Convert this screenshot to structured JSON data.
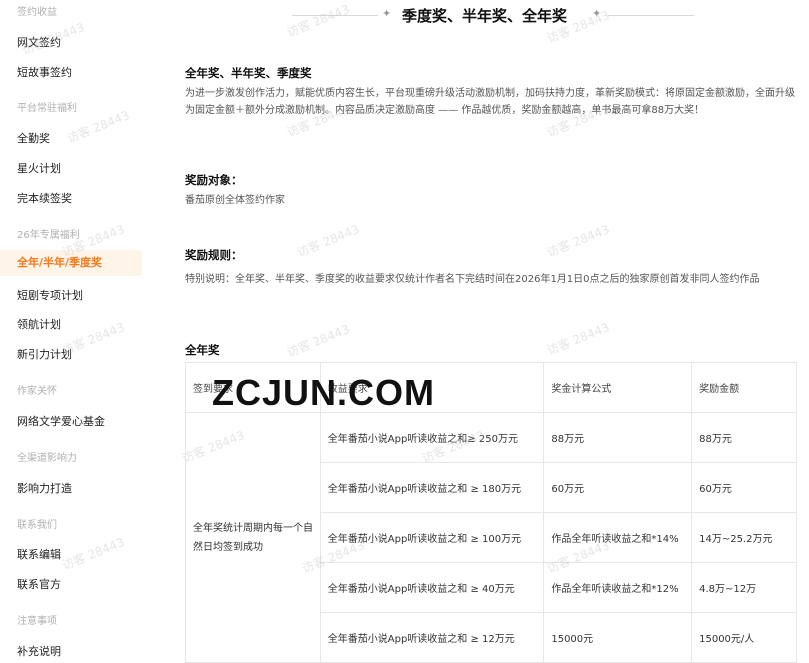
{
  "sidebar": {
    "sections": [
      {
        "label": "签约收益"
      },
      {
        "label": "平台常驻福利"
      },
      {
        "label": "26年专属福利"
      },
      {
        "label": "作家关怀"
      },
      {
        "label": "全渠道影响力"
      },
      {
        "label": "联系我们"
      },
      {
        "label": "注意事项"
      }
    ],
    "items": [
      {
        "label": "网文签约"
      },
      {
        "label": "短故事签约"
      },
      {
        "label": "全勤奖"
      },
      {
        "label": "星火计划"
      },
      {
        "label": "完本续签奖"
      },
      {
        "label": "全年/半年/季度奖"
      },
      {
        "label": "短剧专项计划"
      },
      {
        "label": "领航计划"
      },
      {
        "label": "新引力计划"
      },
      {
        "label": "网络文学爱心基金"
      },
      {
        "label": "影响力打造"
      },
      {
        "label": "联系编辑"
      },
      {
        "label": "联系官方"
      },
      {
        "label": "补充说明"
      }
    ],
    "active_item": "全年/半年/季度奖",
    "accent_color": "#f47a20"
  },
  "page": {
    "title": "季度奖、半年奖、全年奖",
    "title_decoration": "✦",
    "intro_heading": "全年奖、半年奖、季度奖",
    "intro_text": "为进一步激发创作活力，赋能优质内容生长，平台现重磅升级活动激励机制，加码扶持力度，革新奖励模式：将原固定金额激励，全面升级为固定金额＋额外分成激励机制。内容品质决定激励高度 —— 作品越优质，奖励金额越高，单书最高可拿88万大奖！",
    "target_heading": "奖励对象：",
    "target_text": "番茄原创全体签约作家",
    "rules_heading": "奖励规则：",
    "rules_text": "特别说明：全年奖、半年奖、季度奖的收益要求仅统计作者名下完结时间在2026年1月1日0点之后的独家原创首发非同人签约作品",
    "annual_heading": "全年奖"
  },
  "table": {
    "headers": [
      "签到要求",
      "收益要求",
      "奖金计算公式",
      "奖励金额"
    ],
    "signin_requirement": "全年奖统计周期内每一个自然日均签到成功",
    "rows": [
      {
        "income": "全年番茄小说App听读收益之和≥ 250万元",
        "formula": "88万元",
        "amount": "88万元"
      },
      {
        "income": "全年番茄小说App听读收益之和 ≥ 180万元",
        "formula": "60万元",
        "amount": "60万元"
      },
      {
        "income": "全年番茄小说App听读收益之和 ≥ 100万元",
        "formula": "作品全年听读收益之和*14%",
        "amount": "14万~25.2万元"
      },
      {
        "income": "全年番茄小说App听读收益之和 ≥ 40万元",
        "formula": "作品全年听读收益之和*12%",
        "amount": "4.8万~12万"
      },
      {
        "income": "全年番茄小说App听读收益之和 ≥ 12万元",
        "formula": "15000元",
        "amount": "15000元/人"
      }
    ]
  },
  "watermark": {
    "text": "访客 28443",
    "site_mark": "ZCJUN.COM"
  }
}
